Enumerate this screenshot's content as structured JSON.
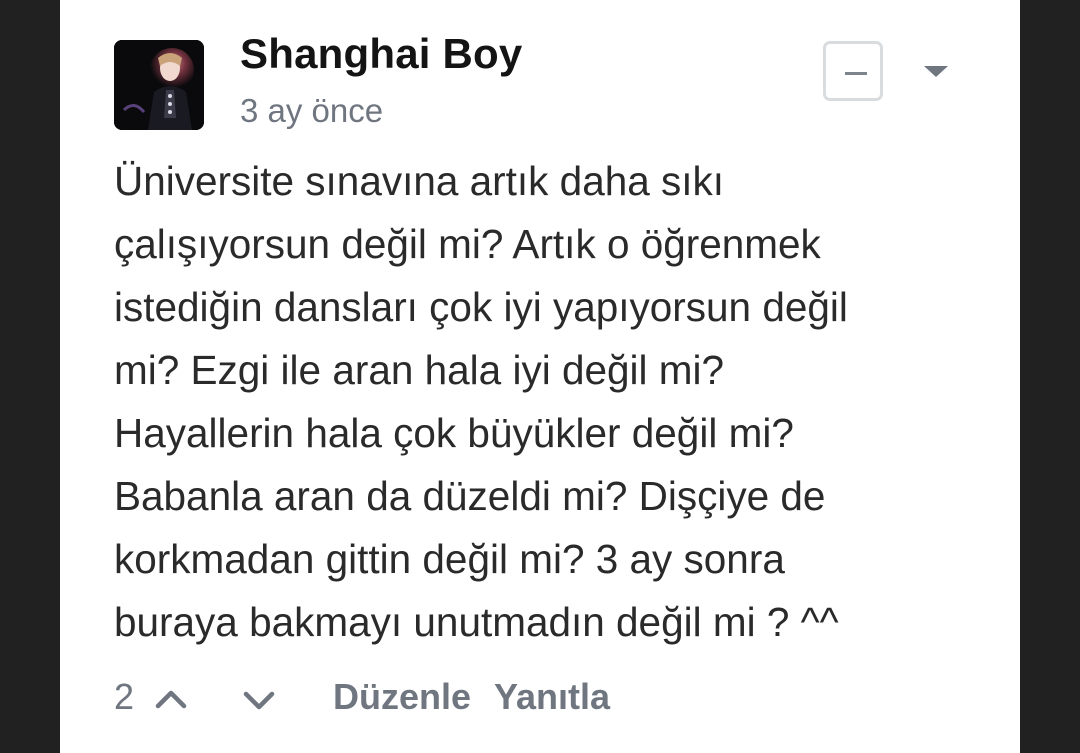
{
  "comment": {
    "author": "Shanghai Boy",
    "timestamp": "3 ay önce",
    "avatar_icon": "user-avatar-photo",
    "collapse_icon": "minus-icon",
    "menu_icon": "caret-down-icon",
    "text_lines": [
      "Üniversite sınavına artık daha sıkı",
      "çalışıyorsun değil mi? Artık o öğrenmek",
      "istediğin dansları çok iyi yapıyorsun değil",
      "mi? Ezgi ile aran hala iyi değil mi?",
      "Hayallerin hala çok büyükler değil mi?",
      "Babanla aran da düzeldi mi? Dişçiye de",
      "korkmadan gittin değil mi? 3 ay sonra",
      "buraya bakmayı unutmadın değil mi ? ^^"
    ]
  },
  "actions": {
    "vote_count": "2",
    "upvote_icon": "chevron-up-icon",
    "downvote_icon": "chevron-down-icon",
    "edit_label": "Düzenle",
    "reply_label": "Yanıtla"
  },
  "colors": {
    "background": "#212121",
    "card": "#ffffff",
    "author": "#141414",
    "body_text": "#2a2a2a",
    "muted": "#6f7680",
    "button_border": "#d9dcdf"
  }
}
